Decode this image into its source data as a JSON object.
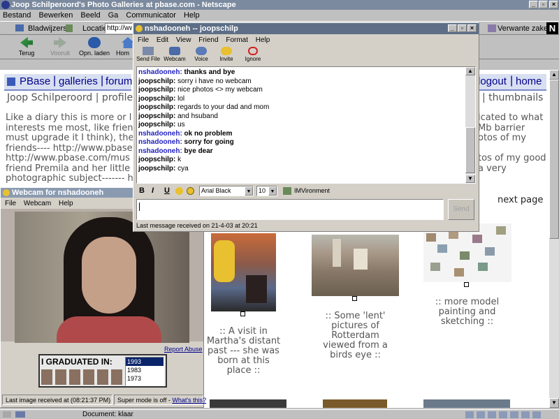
{
  "netscape": {
    "title": "Joop Schilperoord's Photo Galleries at pbase.com - Netscape",
    "menu": [
      "Bestand",
      "Bewerken",
      "Beeld",
      "Ga",
      "Communicator",
      "Help"
    ],
    "bookmarks_label": "Bladwijzers",
    "location_label": "Locatie:",
    "location_value": "http://ww",
    "related_label": "Verwante zaken",
    "toolbar": {
      "back": "Terug",
      "forward": "Vooruit",
      "reload": "Opn. laden",
      "home": "Hom"
    },
    "status": "Document: klaar"
  },
  "page": {
    "nav_pbase": "PBase",
    "nav_galleries": "galleries",
    "nav_forum": "forum",
    "nav_logout": "logout",
    "nav_home": "home",
    "profile_line": "Joop Schilperoord | profile",
    "thumbnails_link": "| thumbnails",
    "para_left_1": "Like a diary this is more or l",
    "para_left_2": "interests me most, like frien",
    "para_left_3": "must upgrade it I think), the",
    "para_left_4": "friends---- http://www.pbase",
    "para_left_5": "http://www.pbase.com/mus",
    "para_left_6": "friend Premila and her little",
    "para_left_7": "photographic subject------- h",
    "para_right_1": "icated to what",
    "para_right_2": "Mb barrier",
    "para_right_3": "otos of my",
    "para_right_4": "tos of my good",
    "para_right_5": "a very",
    "next_page": "next page",
    "caption_1": [
      ":: A visit in",
      "Martha's distant",
      "past --- she was",
      "born at this",
      "place ::"
    ],
    "caption_2": [
      ":: Some 'lent'",
      "pictures of",
      "Rotterdam",
      "viewed from a",
      "birds eye ::"
    ],
    "caption_3": [
      ":: more model",
      "painting and",
      "sketching ::"
    ]
  },
  "webcam": {
    "title": "Webcam for nshadooneh",
    "menu": [
      "File",
      "Webcam",
      "Help"
    ],
    "report_abuse": "Report Abuse",
    "graduated_label": "I GRADUATED IN:",
    "years": [
      "1993",
      "1983",
      "1973"
    ],
    "status_left": "Last image received at (08:21:37 PM)",
    "status_mid": "Super mode is off -",
    "whats_this": "What's this?"
  },
  "chat": {
    "title": "nshadooneh -- joopschilp",
    "menu": [
      "File",
      "Edit",
      "View",
      "Friend",
      "Format",
      "Help"
    ],
    "tools": [
      "Send File",
      "Webcam",
      "Voice",
      "Invite",
      "Ignore"
    ],
    "messages": [
      {
        "who": "nshadooneh:",
        "text": "thanks and bye",
        "bold": true
      },
      {
        "who": "joopschilp:",
        "text": "sorry i have no webcam",
        "bold": false
      },
      {
        "who": "joopschilp:",
        "text": "nice photos <> my webcam",
        "bold": false
      },
      {
        "who": "joopschilp:",
        "text": "lol",
        "bold": false
      },
      {
        "who": "joopschilp:",
        "text": "regards to your dad and mom",
        "bold": false
      },
      {
        "who": "joopschilp:",
        "text": "and hsuband",
        "bold": false
      },
      {
        "who": "joopschilp:",
        "text": "us",
        "bold": false
      },
      {
        "who": "nshadooneh:",
        "text": "ok no problem",
        "bold": true
      },
      {
        "who": "nshadooneh:",
        "text": "sorry for going",
        "bold": true
      },
      {
        "who": "nshadooneh:",
        "text": "bye dear",
        "bold": true
      },
      {
        "who": "joopschilp:",
        "text": "k",
        "bold": false
      },
      {
        "who": "joopschilp:",
        "text": "cya",
        "bold": false
      }
    ],
    "format_bold": "B",
    "format_italic": "I",
    "format_underline": "U",
    "font_name": "Arial Black",
    "font_size": "10",
    "imvironment": "IMVironment",
    "send": "Send",
    "status": "Last message received on 21-4-03 at 20:21"
  },
  "colors": {
    "nshadooneh": "#1f1fbf",
    "joopschilp": "#000000",
    "title_blue": "#5d6e86",
    "link": "#00008b"
  }
}
